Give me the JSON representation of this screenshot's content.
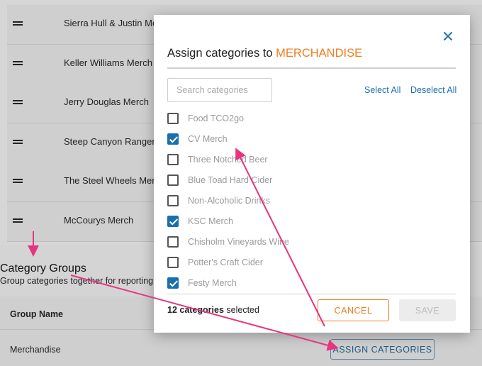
{
  "background": {
    "rows": [
      {
        "label": "Sierra Hull & Justin Mo"
      },
      {
        "label": "Keller Williams Merch"
      },
      {
        "label": "Jerry Douglas Merch"
      },
      {
        "label": "Steep Canyon Rangers"
      },
      {
        "label": "The Steel Wheels Merc"
      },
      {
        "label": "McCourys Merch"
      }
    ],
    "groups_title": "Category Groups",
    "groups_subtitle": "Group categories together for reporting",
    "table_header_name": "Group Name",
    "group_row_name": "Merchandise",
    "assign_button_label": "ASSIGN CATEGORIES"
  },
  "modal": {
    "title_prefix": "Assign categories to ",
    "title_target": "MERCHANDISE",
    "close_icon": "close-icon",
    "search_placeholder": "Search categories",
    "select_all_label": "Select All",
    "deselect_all_label": "Deselect All",
    "items": [
      {
        "label": "Food TCO2go",
        "checked": false
      },
      {
        "label": "CV Merch",
        "checked": true
      },
      {
        "label": "Three Notched Beer",
        "checked": false
      },
      {
        "label": "Blue Toad Hard Cider",
        "checked": false
      },
      {
        "label": "Non-Alcoholic Drinks",
        "checked": false
      },
      {
        "label": "KSC Merch",
        "checked": true
      },
      {
        "label": "Chisholm Vineyards Wine",
        "checked": false
      },
      {
        "label": "Potter's Craft Cider",
        "checked": false
      },
      {
        "label": "Festy Merch",
        "checked": true
      }
    ],
    "selected_count": "12 categories",
    "selected_suffix": " selected",
    "cancel_label": "CANCEL",
    "save_label": "SAVE"
  },
  "colors": {
    "accent_orange": "#f07c1e",
    "accent_blue": "#1a6fb0",
    "annotation_pink": "#e8347e"
  }
}
